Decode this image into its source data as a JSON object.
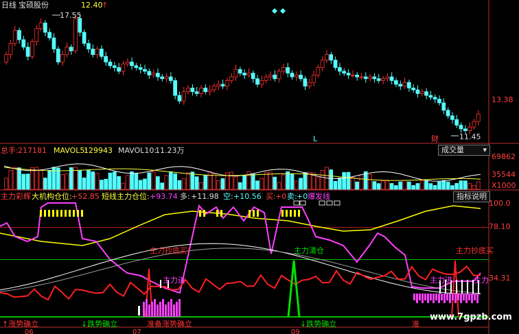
{
  "header": {
    "period": "日线",
    "stock": "宝硕股份",
    "price": "12.40",
    "arrow": "↑"
  },
  "price_panel": {
    "high_label": "17.55",
    "low_label": "11.45",
    "axis_label": "13.38",
    "marker_L": "L",
    "marker_cai": "财"
  },
  "volume_panel": {
    "total_label": "总手:",
    "total_value": "217181",
    "mavol5_label": "MAVOL5:",
    "mavol5_value": "129943",
    "mavol10_label": "MAVOL10:",
    "mavol10_value": "11.23万",
    "dropdown": "成交量",
    "axis": [
      "69862",
      "35544",
      "X1000"
    ]
  },
  "indicator_panel": {
    "name": "主力彩辉",
    "inst_label": "大机构仓位:",
    "inst_value": "+52.85",
    "short_label": "短线主力仓位:",
    "short_value": "+93.74",
    "duo_label": "多:",
    "duo_value": "+11.98",
    "kong_label": "空:",
    "kong_value": "+10.56",
    "buy_label": "买:",
    "buy_value": "+0",
    "sell_label": "卖:",
    "sell_value": "+0",
    "burst": "爆发线",
    "help_button": "指标说明",
    "axis": [
      "100.0",
      "78.10",
      "34.31"
    ],
    "annotations": {
      "bottom_buy": "主力抄底买!",
      "clear": "主力清仓",
      "enter1": "主力进",
      "enter2": "主力进",
      "bottom_buy2": "主力抄底买",
      "enter3": "主力"
    },
    "trend_labels": {
      "up1": "↑涨势确立",
      "down1": "↓跌势确立",
      "up2": "准备涨势确立",
      "down2": "↓跌势确立",
      "zhun": "准"
    }
  },
  "date_axis": [
    "06",
    "07",
    "09"
  ],
  "watermark": "www.7gpzb.com",
  "colors": {
    "up": "#ff3232",
    "down": "#54ffff",
    "yellow": "#ffff00",
    "magenta": "#ff40ff",
    "green": "#00e000",
    "red_line": "#ff2020"
  },
  "chart_data": [
    {
      "type": "candlestick",
      "title": "宝硕股份 日线",
      "annotated_high": 17.55,
      "annotated_low": 11.45,
      "axis_tick": 13.38,
      "closes": [
        15.6,
        16.2,
        16.9,
        16.4,
        16.0,
        15.5,
        16.3,
        17.0,
        17.3,
        16.8,
        16.5,
        15.9,
        15.2,
        15.6,
        16.0,
        15.8,
        17.55,
        16.8,
        16.2,
        15.9,
        15.6,
        15.9,
        15.5,
        15.2,
        15.0,
        14.9,
        14.7,
        15.1,
        15.2,
        15.0,
        14.9,
        14.8,
        14.7,
        14.5,
        14.6,
        14.4,
        14.3,
        14.4,
        14.2,
        13.4,
        13.1,
        13.6,
        13.8,
        13.6,
        13.5,
        13.8,
        13.6,
        13.7,
        13.9,
        14.0,
        13.9,
        14.2,
        14.4,
        14.8,
        14.6,
        14.5,
        14.6,
        14.3,
        14.0,
        14.2,
        14.4,
        14.5,
        14.3,
        14.7,
        14.9,
        14.6,
        14.4,
        14.5,
        14.3,
        13.9,
        14.1,
        14.5,
        14.9,
        15.3,
        15.6,
        15.3,
        14.9,
        14.7,
        14.6,
        14.5,
        14.5,
        14.4,
        14.4,
        14.3,
        14.4,
        14.3,
        14.2,
        14.3,
        14.4,
        14.2,
        14.0,
        13.9,
        14.1,
        13.8,
        13.7,
        13.5,
        13.6,
        13.4,
        13.3,
        13.2,
        13.0,
        12.6,
        12.3,
        12.1,
        11.8,
        11.6,
        11.5,
        11.7,
        12.0,
        12.4
      ]
    },
    {
      "type": "bar",
      "title": "成交量",
      "series": [
        {
          "name": "总手",
          "last": 217181
        },
        {
          "name": "MAVOL5",
          "last": 129943
        },
        {
          "name": "MAVOL10",
          "last": 112300
        }
      ],
      "ylim_ticks": [
        69862,
        35544
      ],
      "unit": "X1000"
    },
    {
      "type": "line",
      "title": "主力彩辉",
      "ylim": [
        0,
        100
      ],
      "ticks": [
        100.0,
        78.1,
        34.31
      ],
      "series": [
        {
          "name": "大机构仓位",
          "last": 52.85
        },
        {
          "name": "短线主力仓位",
          "last": 93.74
        },
        {
          "name": "多",
          "last": 11.98
        },
        {
          "name": "空",
          "last": 10.56
        },
        {
          "name": "买",
          "last": 0
        },
        {
          "name": "卖",
          "last": 0
        }
      ]
    }
  ]
}
